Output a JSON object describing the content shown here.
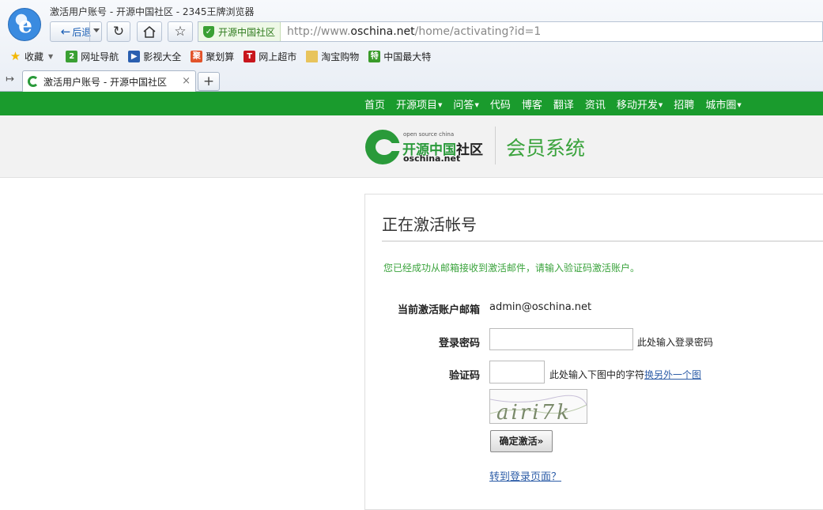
{
  "browser": {
    "window_title": "激活用户账号 - 开源中国社区 - 2345王牌浏览器",
    "back_label": "后退",
    "secure_site_label": "开源中国社区",
    "url_prefix": "http://www.",
    "url_domain": "oschina.net",
    "url_path": "/home/activating?id=1",
    "bookmarks": [
      {
        "label": "收藏",
        "icon": "star-icon",
        "color": "#f2b705"
      },
      {
        "label": "网址导航",
        "icon": "2345-nav-icon",
        "color": "#3aa033"
      },
      {
        "label": "影视大全",
        "icon": "video-icon",
        "color": "#2a5fb0"
      },
      {
        "label": "聚划算",
        "icon": "juhuasuan-icon",
        "color": "#e2542b"
      },
      {
        "label": "网上超市",
        "icon": "tmall-icon",
        "color": "#c8161d"
      },
      {
        "label": "淘宝购物",
        "icon": "folder-icon",
        "color": "#e8c45c"
      },
      {
        "label": "中国最大特",
        "icon": "te-icon",
        "color": "#3a9b2a"
      }
    ],
    "tab_title": "激活用户账号 - 开源中国社区",
    "tab_close": "×",
    "new_tab": "+"
  },
  "site": {
    "nav": [
      {
        "label": "首页",
        "dropdown": false
      },
      {
        "label": "开源项目",
        "dropdown": true
      },
      {
        "label": "问答",
        "dropdown": true
      },
      {
        "label": "代码",
        "dropdown": false
      },
      {
        "label": "博客",
        "dropdown": false
      },
      {
        "label": "翻译",
        "dropdown": false
      },
      {
        "label": "资讯",
        "dropdown": false
      },
      {
        "label": "移动开发",
        "dropdown": true
      },
      {
        "label": "招聘",
        "dropdown": false
      },
      {
        "label": "城市圈",
        "dropdown": true
      }
    ],
    "logo_small": "open source china",
    "logo_name_a": "开源中国",
    "logo_name_b": "社区",
    "logo_domain": "oschina.net",
    "header_title": "会员系统",
    "brand_color": "#1a9b2d"
  },
  "panel": {
    "title": "正在激活帐号",
    "notice": "您已经成功从邮箱接收到激活邮件，请输入验证码激活账户。",
    "email_label": "当前激活账户邮箱",
    "email_value": "admin@oschina.net",
    "password_label": "登录密码",
    "password_value": "",
    "password_hint": "此处输入登录密码",
    "code_label": "验证码",
    "code_value": "",
    "code_hint": "此处输入下图中的字符",
    "code_refresh_link": "换另外一个图",
    "captcha_text": "airi7k",
    "submit_label": "确定激活»",
    "login_link": "转到登录页面？"
  }
}
